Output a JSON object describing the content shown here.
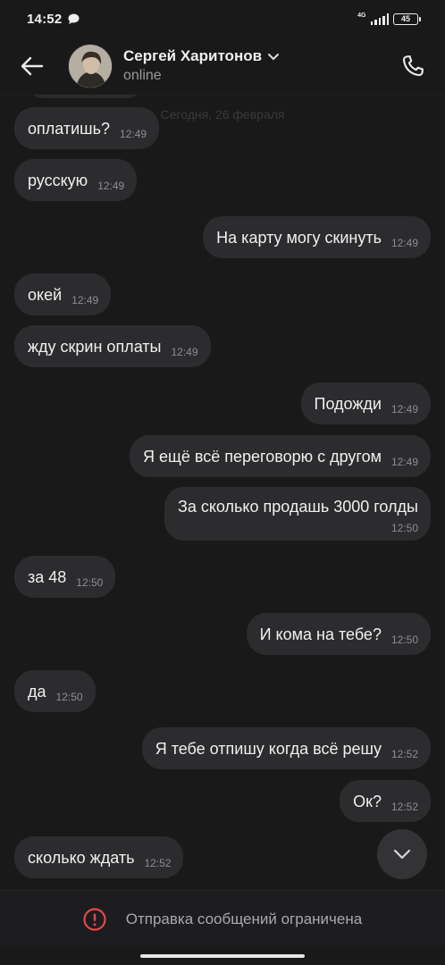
{
  "status_bar": {
    "time": "14:52",
    "network": "4G",
    "battery": "45"
  },
  "header": {
    "contact_name": "Сергей Харитонов",
    "contact_status": "online"
  },
  "chat": {
    "date_separator": "Сегодня, 26 февраля",
    "messages": [
      {
        "side": "in",
        "text": "оплатишь?",
        "time": "12:49"
      },
      {
        "side": "in",
        "text": "русскую",
        "time": "12:49"
      },
      {
        "side": "out",
        "text": "На карту могу скинуть",
        "time": "12:49"
      },
      {
        "side": "in",
        "text": "окей",
        "time": "12:49"
      },
      {
        "side": "in",
        "text": "жду скрин оплаты",
        "time": "12:49"
      },
      {
        "side": "out",
        "text": "Подожди",
        "time": "12:49"
      },
      {
        "side": "out",
        "text": "Я ещё всё переговорю с другом",
        "time": "12:49"
      },
      {
        "side": "out",
        "text": "За сколько продашь 3000 голды",
        "time": "12:50"
      },
      {
        "side": "in",
        "text": "за 48",
        "time": "12:50"
      },
      {
        "side": "out",
        "text": "И кома на тебе?",
        "time": "12:50"
      },
      {
        "side": "in",
        "text": "да",
        "time": "12:50"
      },
      {
        "side": "out",
        "text": "Я тебе отпишу когда всё решу",
        "time": "12:52"
      },
      {
        "side": "out",
        "text": "Ок?",
        "time": "12:52"
      },
      {
        "side": "in",
        "text": "сколько ждать",
        "time": "12:52"
      }
    ]
  },
  "footer": {
    "restriction_text": "Отправка сообщений ограничена"
  },
  "colors": {
    "background": "#19191a",
    "bubble": "#2c2c2e",
    "warning": "#e5484d"
  },
  "icons": [
    "chat-bubble-icon",
    "signal-icon",
    "battery-icon",
    "back-arrow-icon",
    "chevron-down-icon",
    "phone-icon",
    "scroll-down-chevron-icon",
    "warning-icon"
  ]
}
